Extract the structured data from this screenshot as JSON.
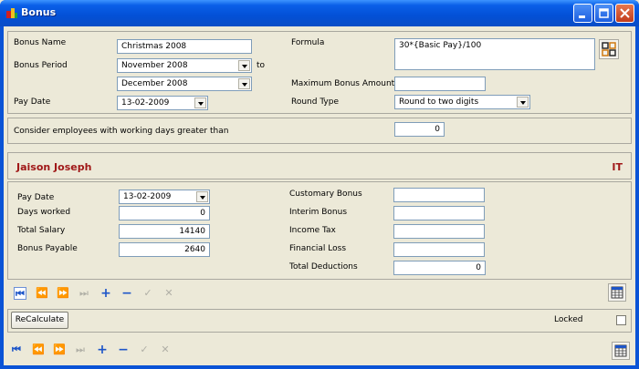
{
  "window": {
    "title": "Bonus"
  },
  "bonus": {
    "name_label": "Bonus Name",
    "name_value": "Christmas 2008",
    "period_label": "Bonus Period",
    "period_from": "November 2008",
    "period_to_label": "to",
    "period_to": "December 2008",
    "paydate_label": "Pay Date",
    "paydate_value": "13-02-2009",
    "formula_label": "Formula",
    "formula_value": "30*{Basic Pay}/100",
    "max_amount_label": "Maximum Bonus Amount",
    "max_amount_value": "",
    "round_type_label": "Round Type",
    "round_type_value": "Round to two digits"
  },
  "criteria": {
    "label": "Consider employees with working days greater than",
    "value": "0"
  },
  "employee": {
    "name": "Jaison Joseph",
    "dept": "IT",
    "paydate_label": "Pay Date",
    "paydate_value": "13-02-2009",
    "days_label": "Days worked",
    "days_value": "0",
    "salary_label": "Total Salary",
    "salary_value": "14140",
    "payable_label": "Bonus Payable",
    "payable_value": "2640",
    "customary_label": "Customary Bonus",
    "customary_value": "",
    "interim_label": "Interim Bonus",
    "interim_value": "",
    "income_tax_label": "Income Tax",
    "income_tax_value": "",
    "financial_loss_label": "Financial Loss",
    "financial_loss_value": "",
    "total_deductions_label": "Total Deductions",
    "total_deductions_value": "0"
  },
  "actions": {
    "recalculate_label": "ReCalculate",
    "locked_label": "Locked"
  }
}
